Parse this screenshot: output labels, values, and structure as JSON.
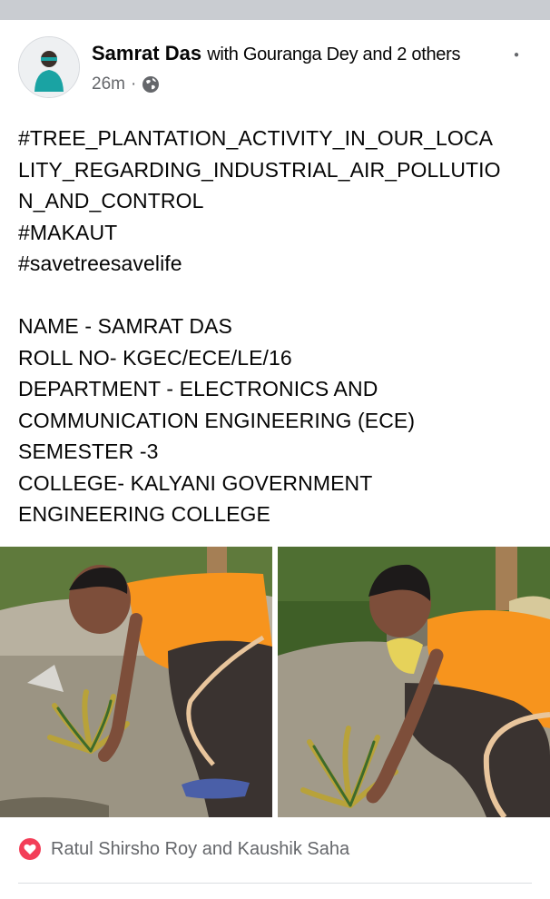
{
  "colors": {
    "accent_love": "#f33e58",
    "secondary_text": "#65676b",
    "shirt_orange": "#f7941d"
  },
  "post": {
    "author": "Samrat Das",
    "with_text": "with Gouranga Dey and 2 others",
    "time": "26m",
    "time_separator": "·",
    "privacy_icon": "globe-icon",
    "text_lines": [
      "#TREE_PLANTATION_ACTIVITY_IN_OUR_LOCA",
      "LITY_REGARDING_INDUSTRIAL_AIR_POLLUTIO",
      "N_AND_CONTROL",
      "#MAKAUT",
      "#savetreesavelife",
      "",
      "NAME - SAMRAT DAS",
      "ROLL NO- KGEC/ECE/LE/16",
      "DEPARTMENT - ELECTRONICS AND",
      "COMMUNICATION ENGINEERING (ECE)",
      "SEMESTER -3",
      "COLLEGE- KALYANI GOVERNMENT",
      "ENGINEERING COLLEGE"
    ]
  },
  "reactions": {
    "icon": "love-reaction-icon",
    "text": "Ratul Shirsho Roy and Kaushik Saha"
  }
}
